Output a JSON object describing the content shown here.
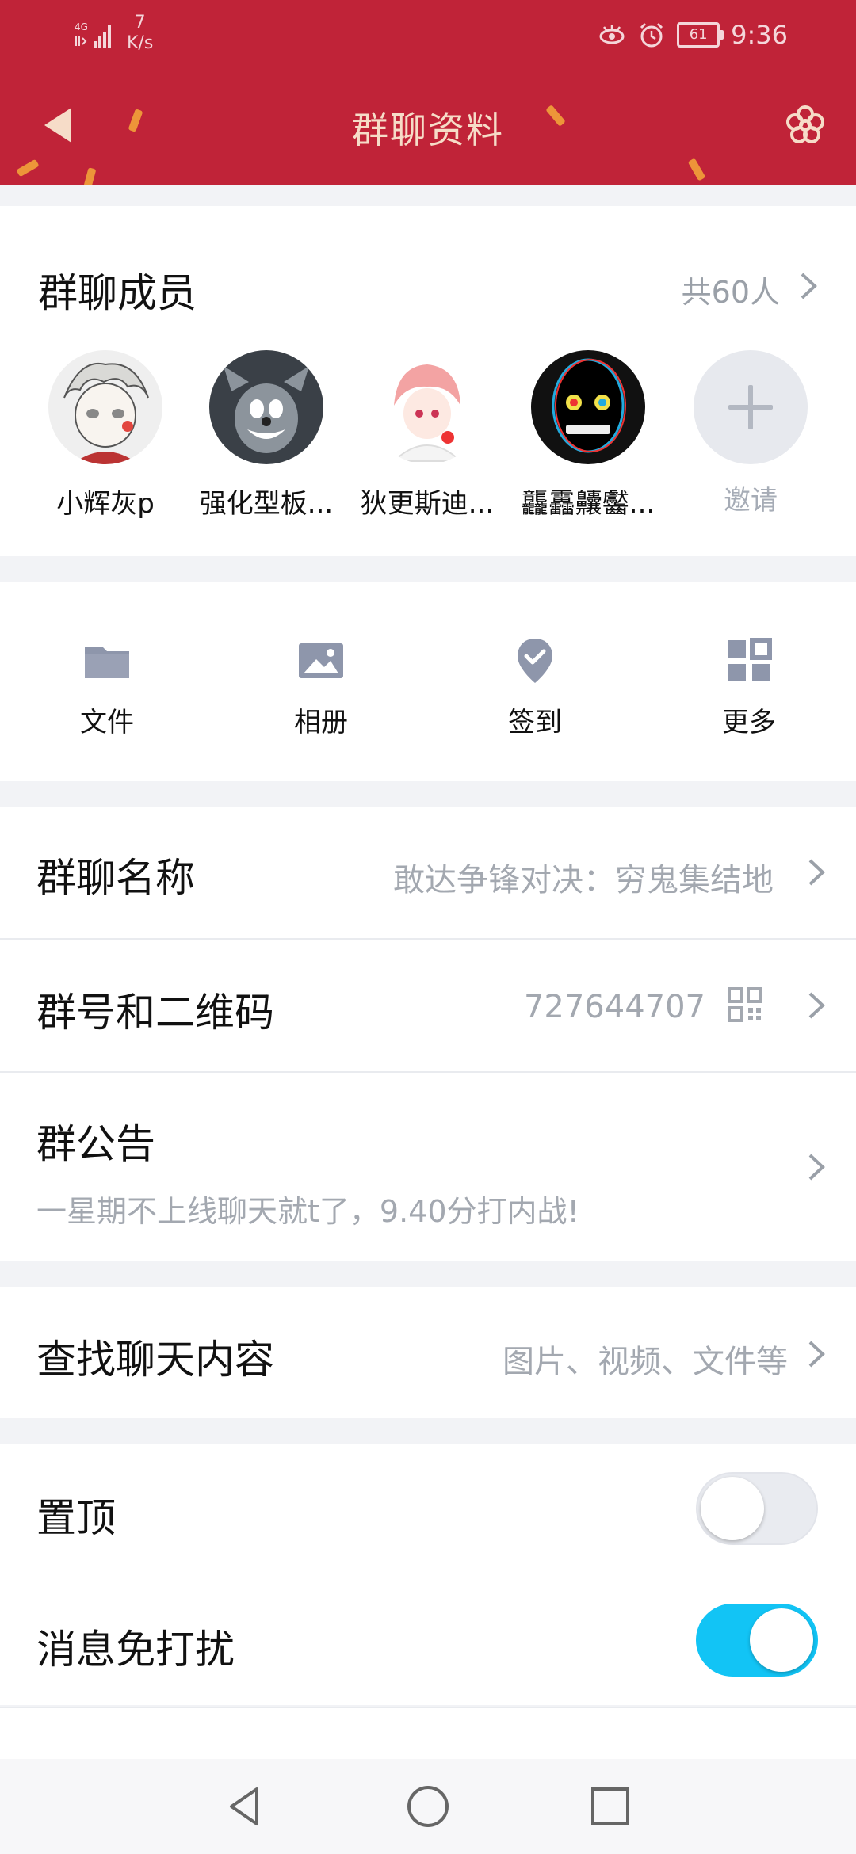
{
  "status_bar": {
    "network": "4G",
    "speed_value": "7",
    "speed_unit": "K/s",
    "battery": "61",
    "time": "9:36"
  },
  "header": {
    "title": "群聊资料",
    "bg_color": "#c02338"
  },
  "members": {
    "title": "群聊成员",
    "count_label": "共60人",
    "list": [
      {
        "name": "小辉灰p"
      },
      {
        "name": "强化型板..."
      },
      {
        "name": "狄更斯迪..."
      },
      {
        "name": "龘靐齉齾..."
      }
    ],
    "invite_label": "邀请"
  },
  "tools": [
    {
      "label": "文件",
      "icon": "folder-icon"
    },
    {
      "label": "相册",
      "icon": "image-icon"
    },
    {
      "label": "签到",
      "icon": "checkin-pin-icon"
    },
    {
      "label": "更多",
      "icon": "grid-more-icon"
    }
  ],
  "info": {
    "group_name": {
      "label": "群聊名称",
      "value": "敢达争锋对决：穷鬼集结地"
    },
    "group_id": {
      "label": "群号和二维码",
      "value": "727644707"
    },
    "announcement": {
      "label": "群公告",
      "text": "一星期不上线聊天就t了，9.40分打内战!"
    }
  },
  "search": {
    "label": "查找聊天内容",
    "hint": "图片、视频、文件等"
  },
  "toggles": {
    "pin": {
      "label": "置顶",
      "on": false
    },
    "mute": {
      "label": "消息免打扰",
      "on": true
    },
    "on_color": "#12c4f5"
  }
}
